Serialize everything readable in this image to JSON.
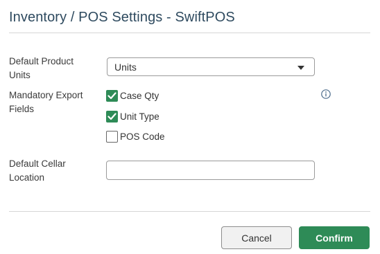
{
  "dialog": {
    "title": "Inventory / POS Settings - SwiftPOS"
  },
  "fields": {
    "default_product_units": {
      "label_line1": "Default Product",
      "label_line2": "Units",
      "selected_value": "Units",
      "caret_icon": "caret-down-icon"
    },
    "mandatory_export_fields": {
      "label_line1": "Mandatory Export",
      "label_line2": "Fields",
      "info_icon": "info-icon",
      "options": [
        {
          "label": "Case Qty",
          "checked": true
        },
        {
          "label": "Unit Type",
          "checked": true
        },
        {
          "label": "POS Code",
          "checked": false
        }
      ]
    },
    "default_cellar_location": {
      "label_line1": "Default Cellar",
      "label_line2": "Location",
      "value": "",
      "placeholder": ""
    }
  },
  "footer": {
    "cancel_label": "Cancel",
    "confirm_label": "Confirm"
  },
  "colors": {
    "title": "#2e4a5f",
    "accent_green": "#2e8b57",
    "info_blue": "#4a6a8a"
  }
}
